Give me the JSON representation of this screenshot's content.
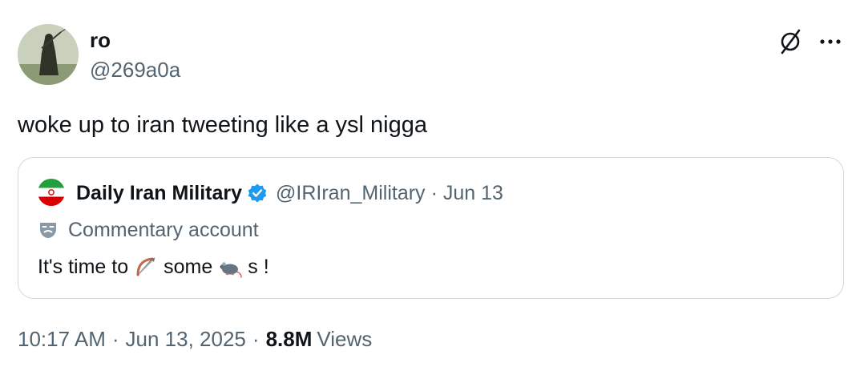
{
  "tweet": {
    "author": {
      "name": "ro",
      "handle": "@269a0a"
    },
    "text": "woke up to iran tweeting like a ysl nigga",
    "quote": {
      "name": "Daily Iran Military",
      "handle": "@IRIran_Military",
      "separator": "·",
      "date": "Jun 13",
      "label": "Commentary account",
      "text_part1": "It's time to",
      "text_part2": "some",
      "text_part3": "s !",
      "emoji_1": "bow-and-arrow-emoji",
      "emoji_2": "rat-emoji"
    },
    "time": "10:17 AM",
    "date": "Jun 13, 2025",
    "separator": "·",
    "views_count": "8.8M",
    "views_label": "Views"
  },
  "icons": {
    "grok": "grok-icon",
    "more": "more-icon",
    "verified": "verified-badge-icon",
    "commentary": "theater-mask-icon"
  },
  "colors": {
    "primary_text": "#0f1419",
    "secondary_text": "#536471",
    "border": "#cfd9de",
    "verified_blue": "#1d9bf0"
  }
}
